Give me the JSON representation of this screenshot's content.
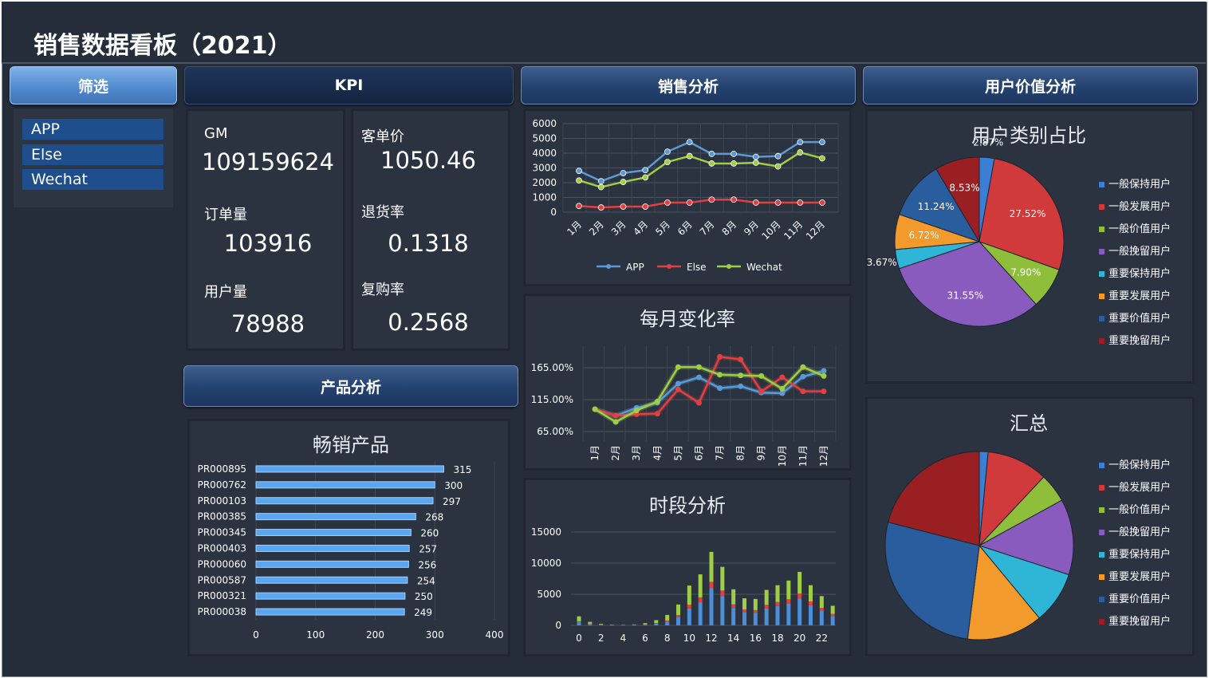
{
  "dashboard_title": "销售数据看板（2021）",
  "headers": {
    "filter": "筛选",
    "kpi": "KPI",
    "sales": "销售分析",
    "user_value": "用户价值分析",
    "product": "产品分析"
  },
  "filter_items": [
    "APP",
    "Else",
    "Wechat"
  ],
  "kpi": {
    "gm_label": "GM",
    "gm_value": "109159624",
    "orders_label": "订单量",
    "orders_value": "103916",
    "users_label": "用户量",
    "users_value": "78988",
    "aov_label": "客单价",
    "aov_value": "1050.46",
    "return_label": "退货率",
    "return_value": "0.1318",
    "repurchase_label": "复购率",
    "repurchase_value": "0.2568"
  },
  "colors": {
    "app": "#5b9bd5",
    "else": "#e0403f",
    "wechat": "#9fce45",
    "bar_blue": "#4a8fd8"
  },
  "chart_data": [
    {
      "type": "line",
      "id": "sales",
      "categories": [
        "1月",
        "2月",
        "3月",
        "4月",
        "5月",
        "6月",
        "7月",
        "8月",
        "9月",
        "10月",
        "11月",
        "12月"
      ],
      "series": [
        {
          "name": "APP",
          "values": [
            2800,
            2100,
            2650,
            2850,
            4100,
            4750,
            3950,
            3950,
            3750,
            3800,
            4750,
            4750
          ]
        },
        {
          "name": "Else",
          "values": [
            420,
            320,
            380,
            380,
            650,
            650,
            850,
            850,
            650,
            650,
            650,
            650
          ]
        },
        {
          "name": "Wechat",
          "values": [
            2150,
            1700,
            2050,
            2350,
            3400,
            3800,
            3300,
            3300,
            3350,
            3100,
            4050,
            3650
          ]
        }
      ],
      "ylim": [
        0,
        6000
      ],
      "yticks": [
        "0",
        "1000",
        "2000",
        "3000",
        "4000",
        "5000",
        "6000"
      ]
    },
    {
      "type": "line",
      "id": "monthly_change",
      "title": "每月变化率",
      "categories": [
        "1月",
        "2月",
        "3月",
        "4月",
        "5月",
        "6月",
        "7月",
        "8月",
        "9月",
        "10月",
        "11月",
        "12月"
      ],
      "series": [
        {
          "name": "APP",
          "values": [
            100,
            90,
            102,
            110,
            140,
            150,
            133,
            136,
            126,
            125,
            151,
            160
          ]
        },
        {
          "name": "Else",
          "values": [
            100,
            90,
            92,
            93,
            131,
            110,
            182,
            178,
            128,
            150,
            128,
            128
          ]
        },
        {
          "name": "Wechat",
          "values": [
            100,
            80,
            98,
            112,
            166,
            166,
            154,
            153,
            152,
            132,
            166,
            152
          ]
        }
      ],
      "ylim": [
        50,
        200
      ],
      "yticks": [
        "65.00%",
        "115.00%",
        "165.00%"
      ]
    },
    {
      "type": "bar",
      "id": "hourly",
      "title": "时段分析",
      "x": [
        0,
        1,
        2,
        3,
        4,
        5,
        6,
        7,
        8,
        9,
        10,
        11,
        12,
        13,
        14,
        15,
        16,
        17,
        18,
        19,
        20,
        21,
        22,
        23
      ],
      "series": [
        {
          "name": "APP",
          "values": [
            500,
            200,
            80,
            40,
            30,
            50,
            120,
            300,
            600,
            1300,
            2700,
            3700,
            6000,
            4700,
            2800,
            2100,
            2000,
            2700,
            3100,
            3500,
            4300,
            3200,
            2300,
            1500
          ]
        },
        {
          "name": "Else",
          "values": [
            150,
            60,
            30,
            15,
            10,
            20,
            40,
            90,
            180,
            350,
            600,
            800,
            1000,
            900,
            600,
            450,
            450,
            600,
            650,
            700,
            800,
            650,
            500,
            350
          ]
        },
        {
          "name": "Wechat",
          "values": [
            800,
            300,
            120,
            60,
            50,
            70,
            200,
            450,
            900,
            1700,
            3100,
            3700,
            4800,
            3800,
            2400,
            1800,
            1800,
            2400,
            2700,
            3000,
            3500,
            2600,
            1900,
            1300
          ]
        }
      ],
      "ylim": [
        0,
        15000
      ],
      "yticks": [
        "0",
        "5000",
        "10000",
        "15000"
      ],
      "xticks": [
        "0",
        "2",
        "4",
        "6",
        "8",
        "10",
        "12",
        "14",
        "16",
        "18",
        "20",
        "22"
      ]
    },
    {
      "type": "bar",
      "id": "top_products",
      "title": "畅销产品",
      "categories": [
        "PR000895",
        "PR000762",
        "PR000103",
        "PR000385",
        "PR000345",
        "PR000403",
        "PR000060",
        "PR000587",
        "PR000321",
        "PR000038"
      ],
      "values": [
        315,
        300,
        297,
        268,
        260,
        257,
        256,
        254,
        250,
        249
      ],
      "xlim": [
        0,
        400
      ],
      "xticks": [
        "0",
        "100",
        "200",
        "300",
        "400"
      ]
    },
    {
      "type": "pie",
      "id": "user_category_share",
      "title": "用户类别占比",
      "categories": [
        "一般保持用户",
        "一般发展用户",
        "一般价值用户",
        "一般挽留用户",
        "重要保持用户",
        "重要发展用户",
        "重要价值用户",
        "重要挽留用户"
      ],
      "values": [
        2.87,
        27.52,
        7.9,
        31.55,
        3.67,
        6.72,
        11.24,
        8.53
      ],
      "labels": [
        "2.87%",
        "27.52%",
        "7.90%",
        "31.55%",
        "3.67%",
        "6.72%",
        "11.24%",
        "8.53%"
      ],
      "colors": [
        "#3a7fd5",
        "#d03a3a",
        "#8fbf3a",
        "#8a5bbf",
        "#2fb5d6",
        "#f39a2c",
        "#2a5d9e",
        "#9a1f22"
      ],
      "legend": "right"
    },
    {
      "type": "pie",
      "id": "summary",
      "title": "汇总",
      "categories": [
        "一般保持用户",
        "一般发展用户",
        "一般价值用户",
        "一般挽留用户",
        "重要保持用户",
        "重要发展用户",
        "重要价值用户",
        "重要挽留用户"
      ],
      "values": [
        1.5,
        10.5,
        5,
        13,
        9,
        13,
        27,
        21
      ],
      "colors": [
        "#3a7fd5",
        "#d03a3a",
        "#8fbf3a",
        "#8a5bbf",
        "#2fb5d6",
        "#f39a2c",
        "#2a5d9e",
        "#9a1f22"
      ],
      "legend": "right"
    }
  ]
}
